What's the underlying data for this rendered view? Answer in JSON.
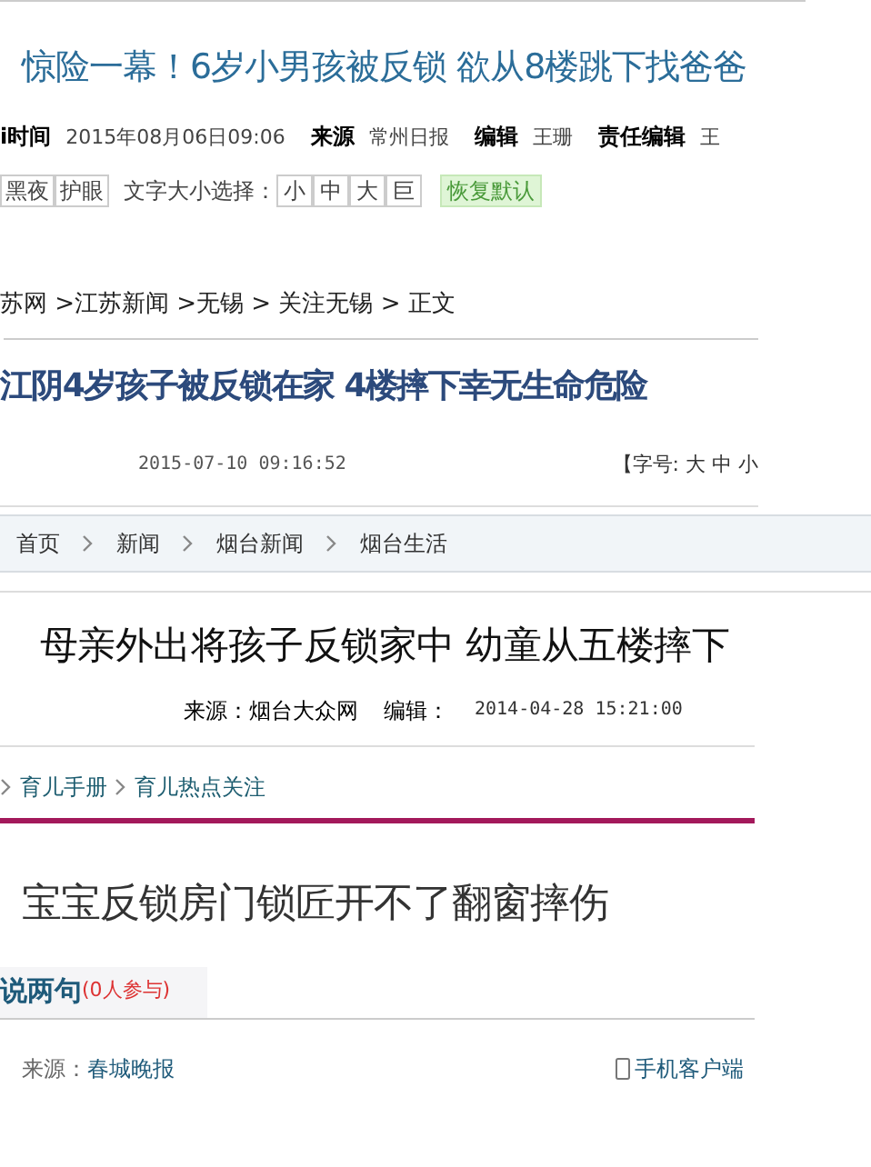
{
  "clip_1": {
    "headline": "惊险一幕！6岁小男孩被反锁  欲从8楼跳下找爸爸",
    "meta": [
      {
        "label": "i时间",
        "value": "2015年08月06日09:06"
      },
      {
        "label": "来源",
        "value": "常州日报"
      },
      {
        "label": "编辑",
        "value": "王珊"
      },
      {
        "label": "责任编辑",
        "value": "王"
      }
    ],
    "modes": [
      "黑夜",
      "护眼"
    ],
    "font_size_label": "文字大小选择：",
    "font_sizes": [
      "小",
      "中",
      "大",
      "巨"
    ],
    "reset": "恢复默认"
  },
  "clip_2": {
    "breadcrumb": "苏网 >江苏新闻 >无锡 > 关注无锡 > 正文",
    "headline": "江阴4岁孩子被反锁在家 4楼摔下幸无生命危险",
    "date": "2015-07-10 09:16:52",
    "font_size": "【字号: 大 中 小"
  },
  "clip_3": {
    "breadcrumb": [
      "首页",
      "新闻",
      "烟台新闻",
      "烟台生活"
    ],
    "headline": "母亲外出将孩子反锁家中  幼童从五楼摔下",
    "source": "来源：烟台大众网",
    "editor": "编辑：",
    "date": "2014-04-28 15:21:00"
  },
  "clip_4": {
    "breadcrumb": [
      "育儿手册",
      "育儿热点关注"
    ]
  },
  "clip_5": {
    "headline": "宝宝反锁房门锁匠开不了翻窗摔伤",
    "comment_tab": "说两句",
    "comment_count": "(0人参与)",
    "source_label": "来源：",
    "source": "春城晚报",
    "mobile": "手机客户端"
  }
}
